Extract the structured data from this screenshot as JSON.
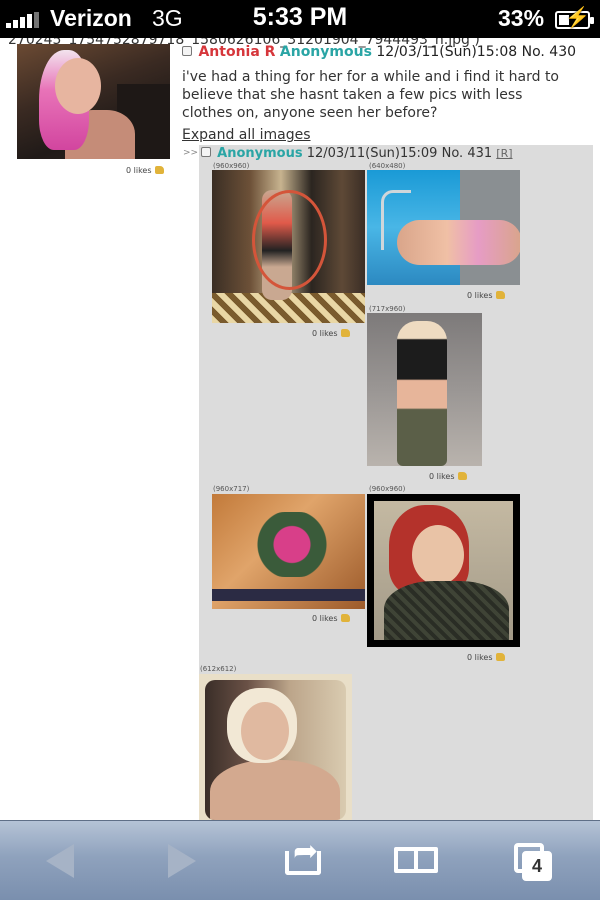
{
  "status_bar": {
    "carrier": "Verizon",
    "network": "3G",
    "time": "5:33 PM",
    "battery": "33%",
    "battery_level": 0.33
  },
  "page": {
    "filename": "270245_1754752879718_1580626106_31201904_7944493_n.jpg )",
    "op_post": {
      "name": "Antonia R",
      "tripname": "Anonymous",
      "datetime": "12/03/11(Sun)15:08",
      "number": "No. 430",
      "body": "i've had a thing for her for a while and i find it hard to believe that she hasnt taken a few pics with less clothes on, anyone seen her before?",
      "likes": "0 likes"
    },
    "expand_link": "Expand all images",
    "reply": {
      "arrow": ">>",
      "name": "Anonymous",
      "datetime": "12/03/11(Sun)15:09",
      "number": "No. 431",
      "reply_link": "[R]",
      "images": [
        {
          "dims": "(960x960)",
          "likes": "0 likes"
        },
        {
          "dims": "(640x480)",
          "likes": "0 likes"
        },
        {
          "dims": "(717x960)",
          "likes": "0 likes"
        },
        {
          "dims": "(960x717)",
          "likes": "0 likes"
        },
        {
          "dims": "(960x960)",
          "likes": "0 likes"
        },
        {
          "dims": "(612x612)",
          "likes": ""
        }
      ]
    }
  },
  "toolbar": {
    "tabs_count": "4",
    "icons": [
      "back-arrow-icon",
      "forward-arrow-icon",
      "share-icon",
      "bookmarks-icon",
      "tabs-icon"
    ]
  }
}
